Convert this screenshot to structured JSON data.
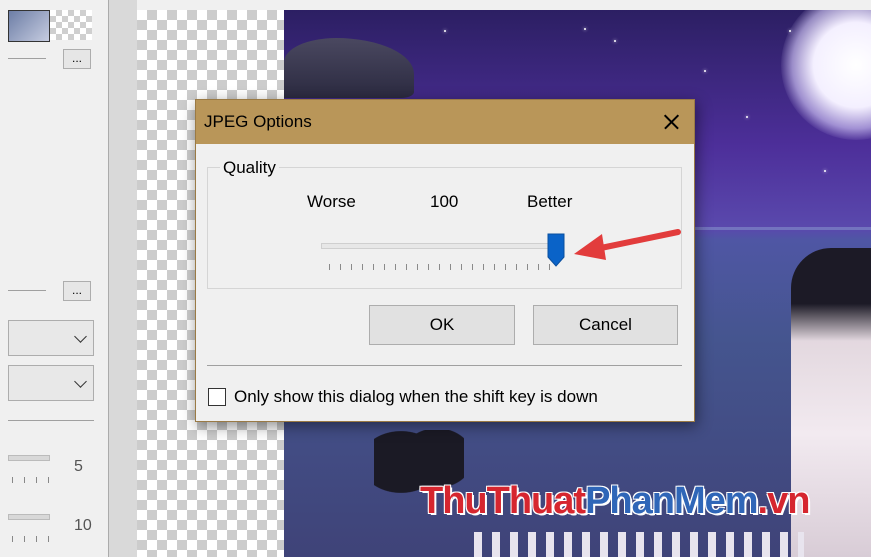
{
  "left_panel": {
    "button_ellipsis_1": "...",
    "button_ellipsis_2": "...",
    "slider_1_value": "5",
    "slider_2_value": "10"
  },
  "watermark": {
    "part1": "ThuThuat",
    "part2": "PhanMem",
    "part3": ".vn"
  },
  "dialog": {
    "title": "JPEG Options",
    "group_label": "Quality",
    "worse_label": "Worse",
    "quality_value": "100",
    "better_label": "Better",
    "quality_slider_level": 1.0,
    "ok_label": "OK",
    "cancel_label": "Cancel",
    "checkbox_label": "Only show this dialog when the shift key is down",
    "checkbox_checked": false
  },
  "colors": {
    "titlebar": "#b99659",
    "slider_thumb": "#0a63c8",
    "arrow": "#e23c3c"
  }
}
